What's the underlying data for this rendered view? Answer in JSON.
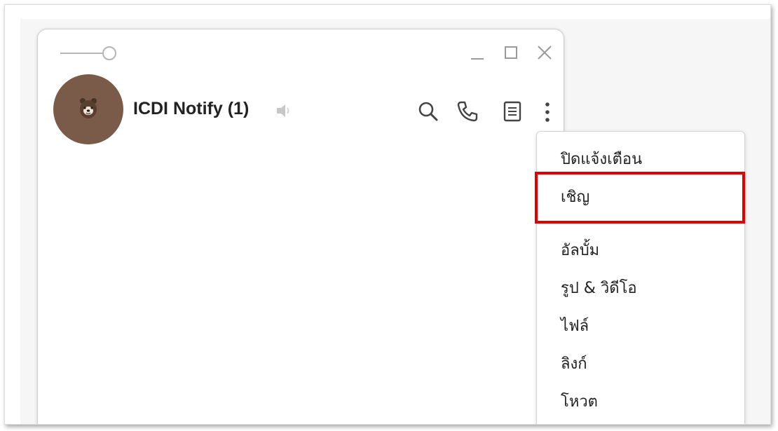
{
  "chat": {
    "title": "ICDI Notify (1)",
    "avatar_icon": "brown-bear-avatar",
    "muted_icon": "speaker-muted-icon"
  },
  "window_controls": [
    "minimize-icon",
    "maximize-icon",
    "close-icon"
  ],
  "header_icons": [
    "search-icon",
    "phone-icon",
    "notes-icon",
    "more-icon"
  ],
  "menu": {
    "items": [
      {
        "label": "ปิดแจ้งเตือน"
      },
      {
        "label": "เชิญ",
        "highlighted": true
      },
      {
        "label": "อัลบั้ม"
      },
      {
        "label": "รูป & วิดีโอ"
      },
      {
        "label": "ไฟล์"
      },
      {
        "label": "ลิงก์"
      },
      {
        "label": "โหวต"
      }
    ]
  },
  "colors": {
    "highlight": "#e00000",
    "avatar": "#7a5a48",
    "icon": "#444444"
  }
}
